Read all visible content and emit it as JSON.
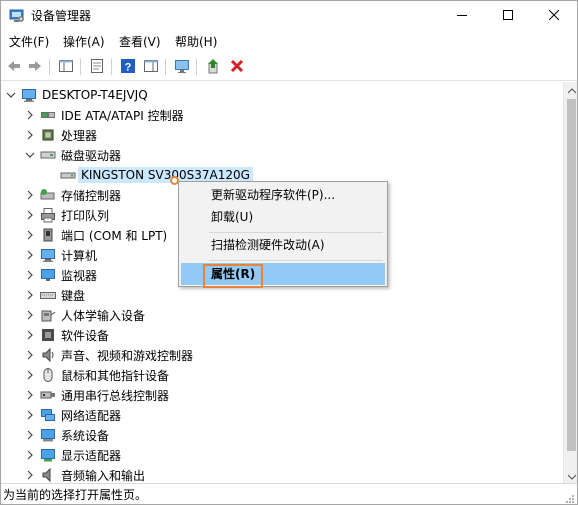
{
  "window": {
    "title": "设备管理器",
    "buttons": {
      "minimize": "minimize-icon",
      "maximize": "maximize-icon",
      "close": "close-icon"
    }
  },
  "menu": [
    {
      "label": "文件(F)"
    },
    {
      "label": "操作(A)"
    },
    {
      "label": "查看(V)"
    },
    {
      "label": "帮助(H)"
    }
  ],
  "toolbar": {
    "icons": [
      "back-arrow-icon",
      "forward-arrow-icon",
      "show-hide-console-tree-icon",
      "properties-icon",
      "help-icon",
      "action-pane-icon",
      "scan-hardware-icon",
      "update-driver-icon",
      "uninstall-icon"
    ],
    "colors": {
      "uninstall": "#d81e28",
      "update": "#2a8a2a",
      "help": "#1f5fbf"
    }
  },
  "tree": {
    "root": "DESKTOP-T4EJVJQ",
    "items": [
      {
        "label": "IDE ATA/ATAPI 控制器",
        "icon": "ide-controller-icon",
        "expanded": false
      },
      {
        "label": "处理器",
        "icon": "processor-icon",
        "expanded": false
      },
      {
        "label": "磁盘驱动器",
        "icon": "disk-drive-icon",
        "expanded": true
      },
      {
        "label": "KINGSTON SV300S37A120G",
        "icon": "disk-icon",
        "child": true,
        "selected": true
      },
      {
        "label": "存储控制器",
        "icon": "storage-controller-icon",
        "expanded": false
      },
      {
        "label": "打印队列",
        "icon": "printer-icon",
        "expanded": false
      },
      {
        "label": "端口 (COM 和 LPT)",
        "icon": "port-icon",
        "expanded": false
      },
      {
        "label": "计算机",
        "icon": "computer-icon",
        "expanded": false
      },
      {
        "label": "监视器",
        "icon": "monitor-icon",
        "expanded": false
      },
      {
        "label": "键盘",
        "icon": "keyboard-icon",
        "expanded": false
      },
      {
        "label": "人体学输入设备",
        "icon": "hid-icon",
        "expanded": false
      },
      {
        "label": "软件设备",
        "icon": "software-device-icon",
        "expanded": false
      },
      {
        "label": "声音、视频和游戏控制器",
        "icon": "sound-icon",
        "expanded": false
      },
      {
        "label": "鼠标和其他指针设备",
        "icon": "mouse-icon",
        "expanded": false
      },
      {
        "label": "通用串行总线控制器",
        "icon": "usb-icon",
        "expanded": false
      },
      {
        "label": "网络适配器",
        "icon": "network-adapter-icon",
        "expanded": false
      },
      {
        "label": "系统设备",
        "icon": "system-device-icon",
        "expanded": false
      },
      {
        "label": "显示适配器",
        "icon": "display-adapter-icon",
        "expanded": false
      },
      {
        "label": "音频输入和输出",
        "icon": "audio-io-icon",
        "expanded": false
      }
    ]
  },
  "context_menu": {
    "items": [
      {
        "label": "更新驱动程序软件(P)..."
      },
      {
        "label": "卸载(U)"
      },
      {
        "label": "扫描检测硬件改动(A)"
      },
      {
        "label": "属性(R)",
        "highlighted": true
      }
    ],
    "highlight_color": "#91c9f7",
    "annotation_color": "#e8843a"
  },
  "status": {
    "text": "为当前的选择打开属性页。"
  }
}
